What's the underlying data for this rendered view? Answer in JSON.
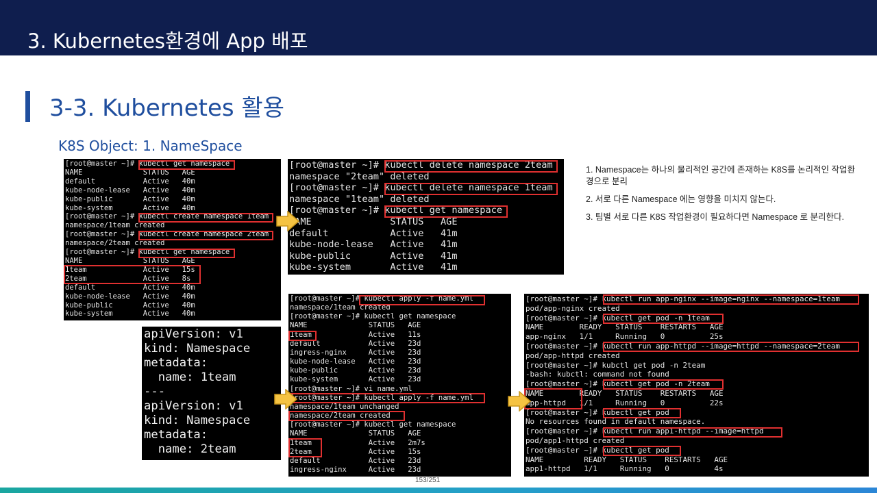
{
  "header": {
    "title": "3.  Kubernetes환경에 App 배포"
  },
  "section": {
    "title": "3-3. Kubernetes 활용",
    "subtitle": "K8S Object: 1. NameSpace"
  },
  "terminal1": {
    "lines": [
      "[root@master ~]# kubectl get namespace",
      "NAME              STATUS   AGE",
      "default           Active   40m",
      "kube-node-lease   Active   40m",
      "kube-public       Active   40m",
      "kube-system       Active   40m",
      "[root@master ~]# kubectl create namespace 1team",
      "namespace/1team created",
      "[root@master ~]# kubectl create namespace 2team",
      "namespace/2team created",
      "[root@master ~]# kubectl get namespace",
      "NAME              STATUS   AGE",
      "1team             Active   15s",
      "2team             Active   8s",
      "default           Active   40m",
      "kube-node-lease   Active   40m",
      "kube-public       Active   40m",
      "kube-system       Active   40m"
    ]
  },
  "terminal2": {
    "lines": [
      "[root@master ~]# kubectl delete namespace 2team",
      "namespace \"2team\" deleted",
      "[root@master ~]# kubectl delete namespace 1team",
      "namespace \"1team\" deleted",
      "[root@master ~]# kubectl get namespace",
      "NAME              STATUS   AGE",
      "default           Active   41m",
      "kube-node-lease   Active   41m",
      "kube-public       Active   41m",
      "kube-system       Active   41m"
    ]
  },
  "yaml": {
    "lines": [
      "apiVersion: v1",
      "kind: Namespace",
      "metadata:",
      "  name: 1team",
      "---",
      "apiVersion: v1",
      "kind: Namespace",
      "metadata:",
      "  name: 2team"
    ]
  },
  "terminal4": {
    "lines": [
      "[root@master ~]# kubectl apply -f name.yml",
      "namespace/1team created",
      "[root@master ~]# kubectl get namespace",
      "NAME              STATUS   AGE",
      "1team             Active   11s",
      "default           Active   23d",
      "ingress-nginx     Active   23d",
      "kube-node-lease   Active   23d",
      "kube-public       Active   23d",
      "kube-system       Active   23d",
      "[root@master ~]# vi name.yml",
      "[root@master ~]# kubectl apply -f name.yml",
      "namespace/1team unchanged",
      "namespace/2team created",
      "[root@master ~]# kubectl get namespace",
      "NAME              STATUS   AGE",
      "1team             Active   2m7s",
      "2team             Active   15s",
      "default           Active   23d",
      "ingress-nginx     Active   23d"
    ]
  },
  "terminal5": {
    "lines": [
      "[root@master ~]# kubectl run app-nginx --image=nginx --namespace=1team",
      "pod/app-nginx created",
      "[root@master ~]# kubectl get pod -n 1team",
      "NAME        READY   STATUS    RESTARTS   AGE",
      "app-nginx   1/1     Running   0          25s",
      "[root@master ~]# kubectl run app-httpd --image=httpd --namespace=2team",
      "pod/app-httpd created",
      "[root@master ~]# kubctl get pod -n 2team",
      "-bash: kubctl: command not found",
      "[root@master ~]# kubectl get pod -n 2team",
      "NAME        READY   STATUS    RESTARTS   AGE",
      "app-httpd   1/1     Running   0          22s",
      "[root@master ~]# kubectl get pod",
      "No resources found in default namespace.",
      "[root@master ~]# kubectl run app1-httpd --image=httpd",
      "pod/app1-httpd created",
      "[root@master ~]# kubectl get pod",
      "NAME         READY   STATUS    RESTARTS   AGE",
      "app1-httpd   1/1     Running   0          4s"
    ]
  },
  "notes": [
    "1. Namespace는 하나의 물리적인 공간에 존재하는 K8S를 논리적인 작업환경으로 분리",
    "2. 서로 다른 Namespace 에는 영향을 미치지 않는다.",
    "3. 팀별 서로 다른 K8S 작업환경이 필요하다면 Namespace 로 분리한다."
  ],
  "footer": {
    "page": "153/251"
  },
  "colors": {
    "header_bg": "#0f1e4e",
    "accent": "#1f4e9e",
    "highlight": "#e03030",
    "arrow": "#f5c342"
  }
}
